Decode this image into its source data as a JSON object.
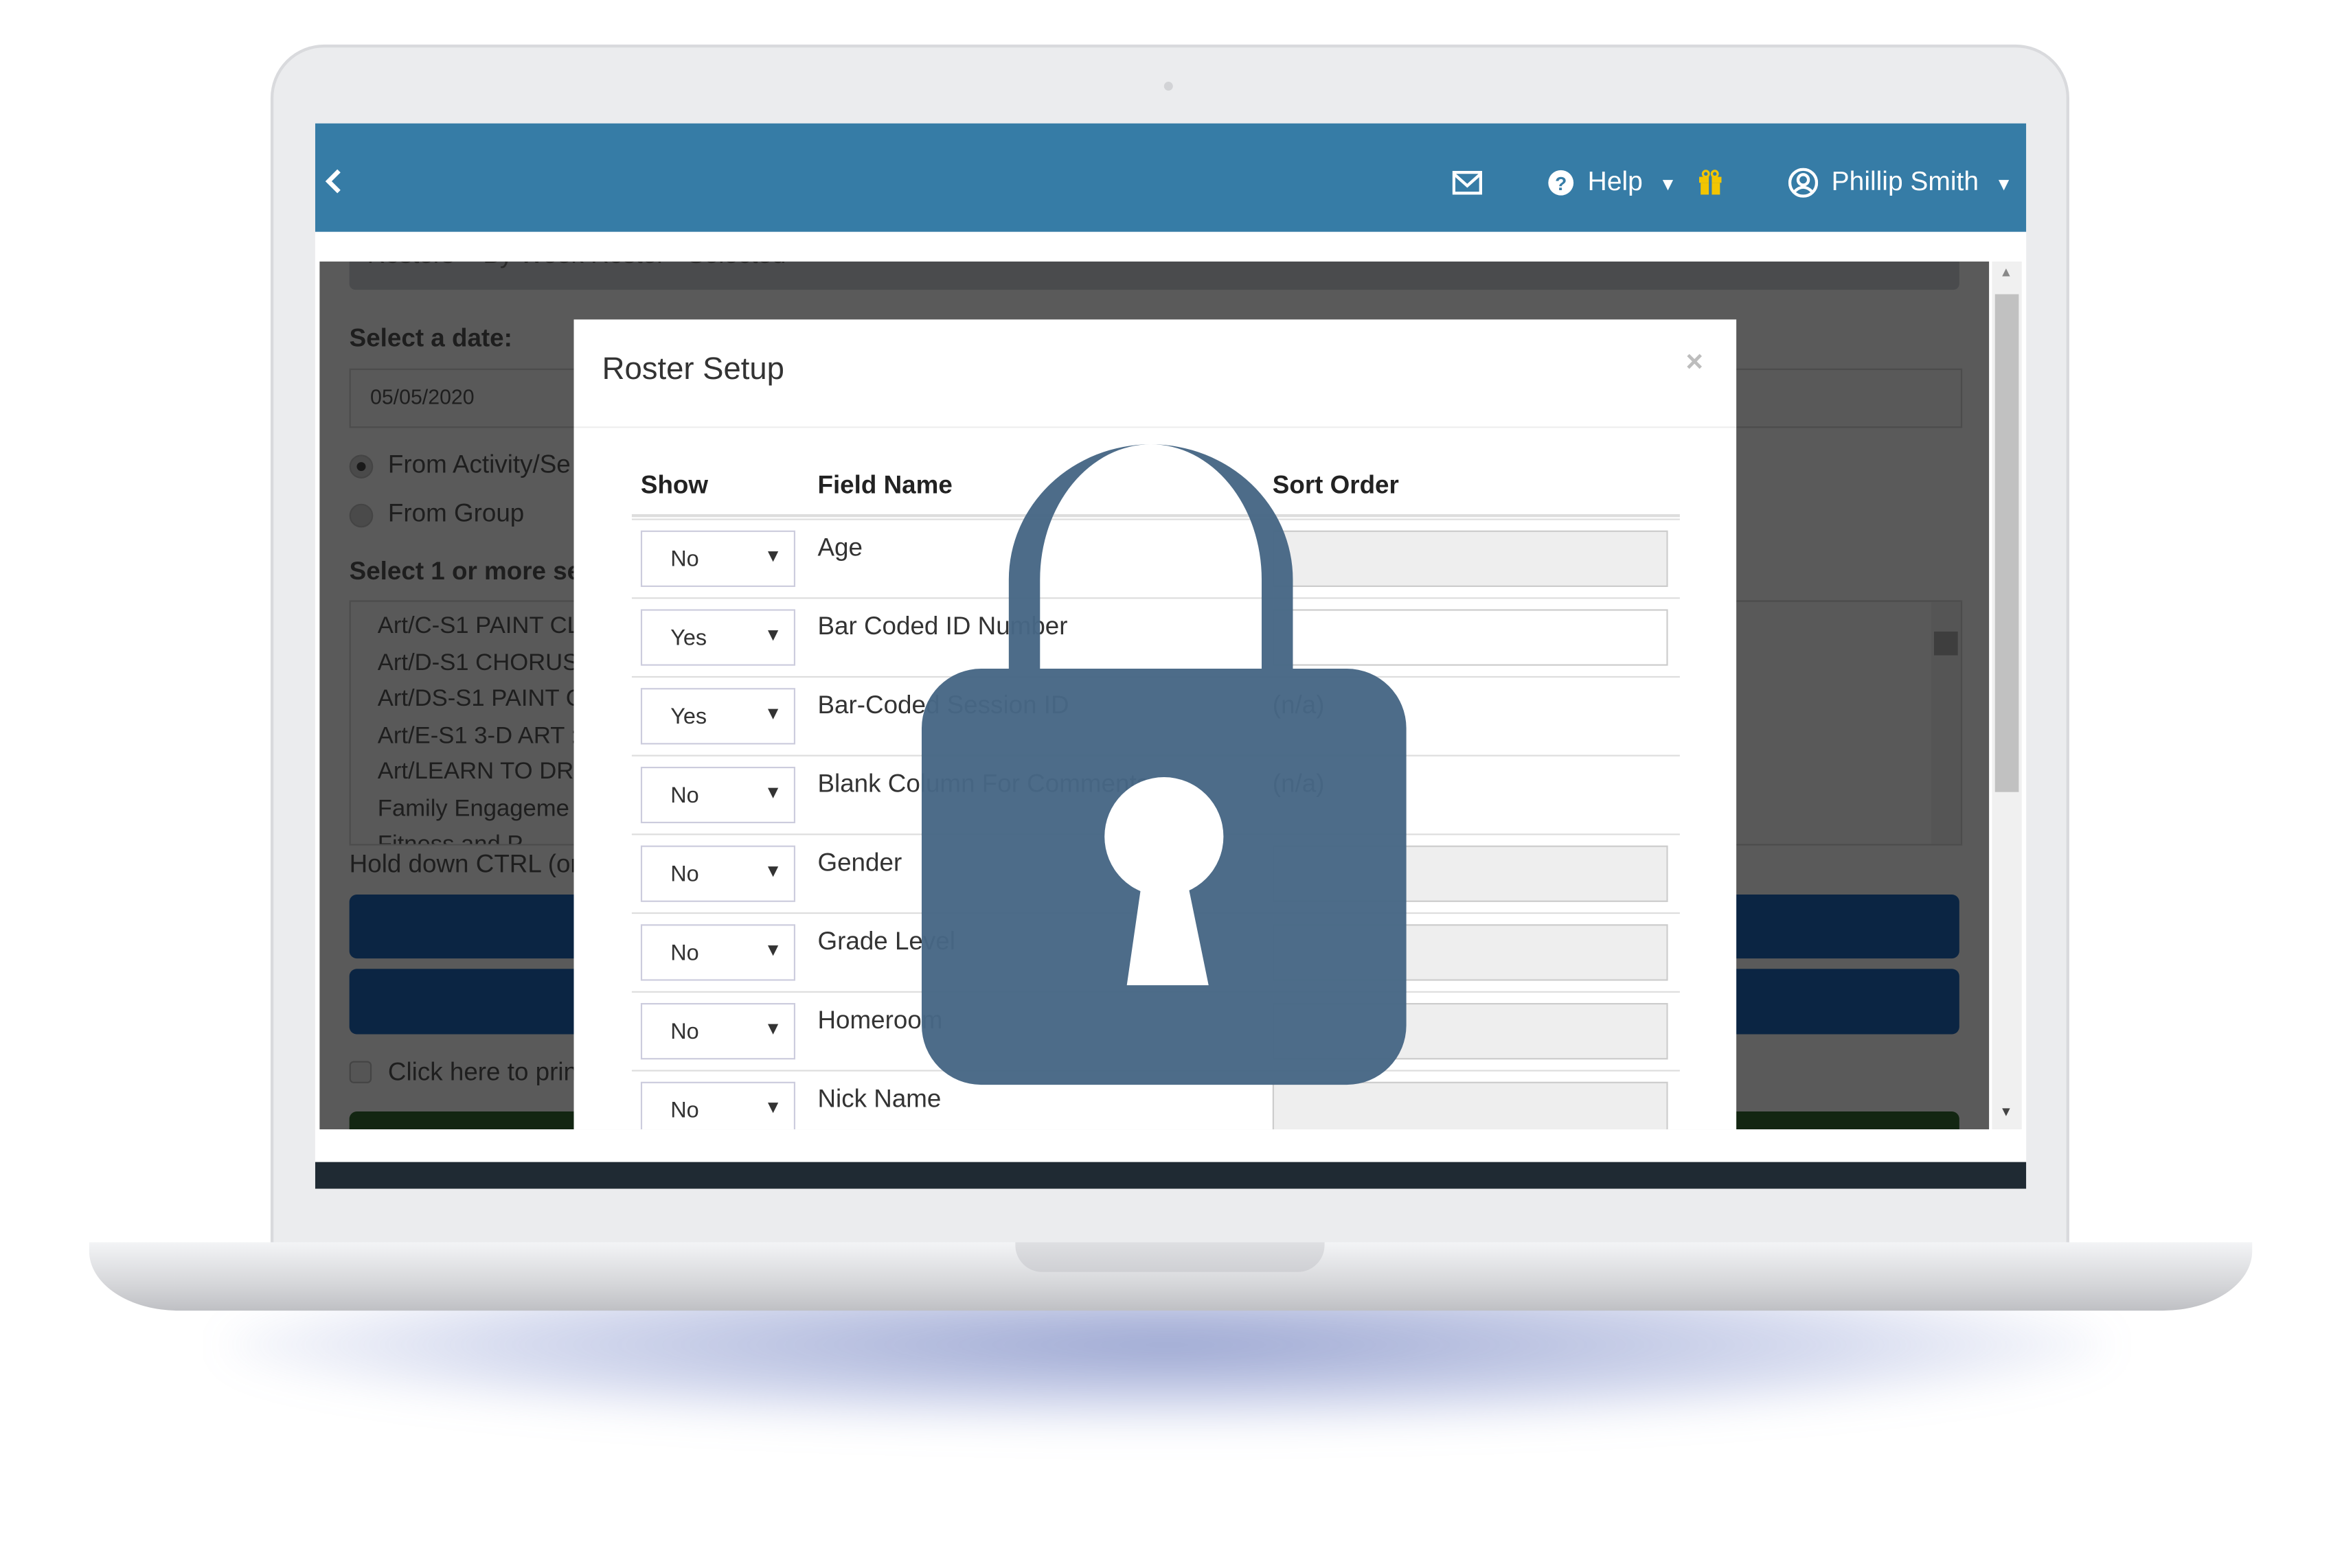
{
  "colors": {
    "header": "#367ca6",
    "lock": "#476785",
    "navy_button": "#0b2543",
    "gift": "#f2c500"
  },
  "topbar": {
    "back_icon": "chevron-left-icon",
    "mail_icon": "envelope-icon",
    "help_label": "Help",
    "gift_icon": "gift-icon",
    "user_name": "Phillip Smith"
  },
  "background": {
    "breadcrumb": "Rosters  >  By Week Roster - Selected",
    "date_label": "Select a date:",
    "date_value": "05/05/2020",
    "radio_activity": "From Activity/Se",
    "radio_group": "From Group",
    "sessions_label": "Select 1 or more se",
    "sessions": [
      "Art/C-S1 PAINT CL",
      "Art/D-S1 CHORUS",
      "Art/DS-S1 PAINT C",
      "Art/E-S1 3-D ART :",
      "Art/LEARN TO DR",
      "Family Engageme",
      "Fitness and P"
    ],
    "hint": "Hold down CTRL (or",
    "print_checkbox": "Click here to prin"
  },
  "modal": {
    "title": "Roster Setup",
    "close": "×",
    "columns": {
      "show": "Show",
      "field": "Field Name",
      "sort": "Sort Order"
    },
    "rows": [
      {
        "show": "No",
        "field": "Age",
        "sort": ""
      },
      {
        "show": "Yes",
        "field": "Bar Coded ID Number",
        "sort": ""
      },
      {
        "show": "Yes",
        "field": "Bar-Coded Session ID",
        "sort": "(n/a)"
      },
      {
        "show": "No",
        "field": "Blank Column For Comments",
        "sort": "(n/a)"
      },
      {
        "show": "No",
        "field": "Gender",
        "sort": ""
      },
      {
        "show": "No",
        "field": "Grade Level",
        "sort": ""
      },
      {
        "show": "No",
        "field": "Homeroom",
        "sort": ""
      },
      {
        "show": "No",
        "field": "Nick Name",
        "sort": ""
      }
    ]
  },
  "overlay_icon": "padlock-icon"
}
